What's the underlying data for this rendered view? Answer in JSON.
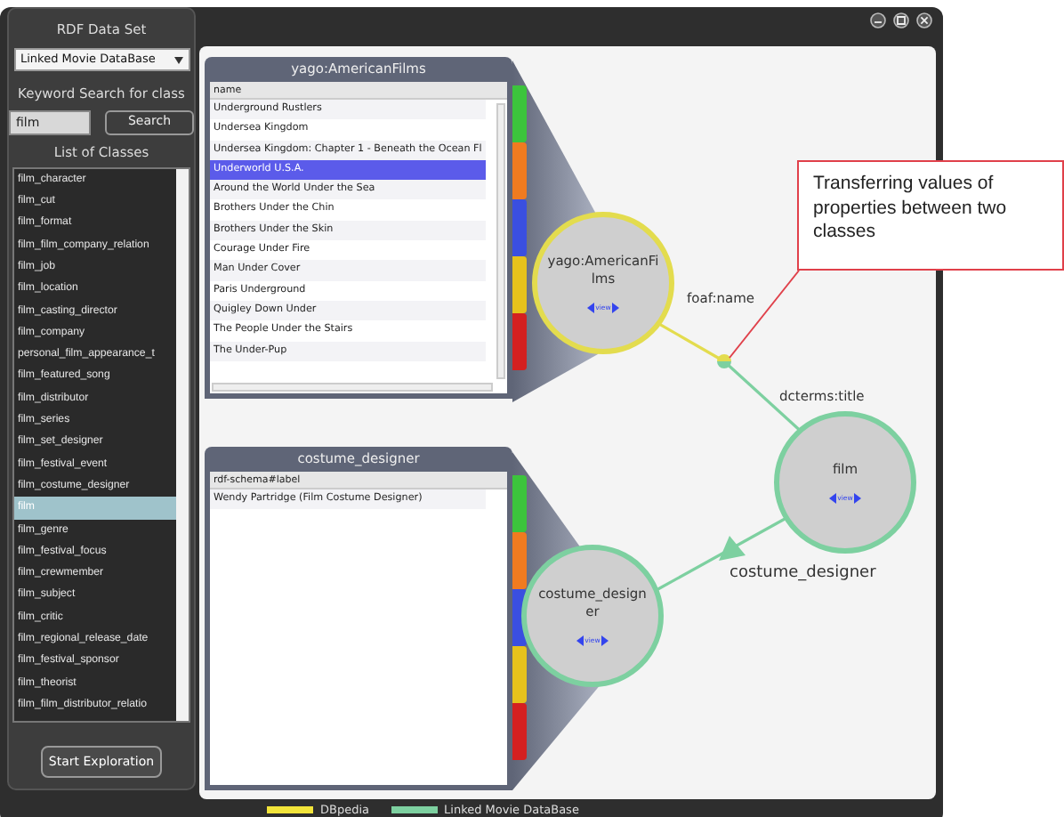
{
  "sidebar": {
    "title": "RDF Data Set",
    "dataset_select": {
      "value": "Linked Movie DataBase"
    },
    "search_label": "Keyword Search for class",
    "search_field": {
      "value": "film"
    },
    "search_button": "Search",
    "list_label": "List of Classes",
    "classes": [
      {
        "label": "film_character",
        "selected": false
      },
      {
        "label": "film_cut",
        "selected": false
      },
      {
        "label": "film_format",
        "selected": false
      },
      {
        "label": "film_film_company_relation",
        "selected": false
      },
      {
        "label": "film_job",
        "selected": false
      },
      {
        "label": "film_location",
        "selected": false
      },
      {
        "label": "film_casting_director",
        "selected": false
      },
      {
        "label": "film_company",
        "selected": false
      },
      {
        "label": "personal_film_appearance_t",
        "selected": false
      },
      {
        "label": "film_featured_song",
        "selected": false
      },
      {
        "label": "film_distributor",
        "selected": false
      },
      {
        "label": "film_series",
        "selected": false
      },
      {
        "label": "film_set_designer",
        "selected": false
      },
      {
        "label": "film_festival_event",
        "selected": false
      },
      {
        "label": "film_costume_designer",
        "selected": false
      },
      {
        "label": "film",
        "selected": true
      },
      {
        "label": "film_genre",
        "selected": false
      },
      {
        "label": "film_festival_focus",
        "selected": false
      },
      {
        "label": "film_crewmember",
        "selected": false
      },
      {
        "label": "film_subject",
        "selected": false
      },
      {
        "label": "film_critic",
        "selected": false
      },
      {
        "label": "film_regional_release_date",
        "selected": false
      },
      {
        "label": "film_festival_sponsor",
        "selected": false
      },
      {
        "label": "film_theorist",
        "selected": false
      },
      {
        "label": "film_film_distributor_relatio",
        "selected": false
      }
    ],
    "start_button": "Start Exploration"
  },
  "panels": [
    {
      "title": "yago:AmericanFilms",
      "columns": [
        "name"
      ],
      "rows": [
        {
          "cells": [
            "Underground Rustlers"
          ],
          "selected": false
        },
        {
          "cells": [
            "Undersea Kingdom"
          ],
          "selected": false
        },
        {
          "cells": [
            "Undersea Kingdom: Chapter 1 - Beneath the Ocean Fl"
          ],
          "selected": false
        },
        {
          "cells": [
            "Underworld U.S.A."
          ],
          "selected": true
        },
        {
          "cells": [
            "Around the World Under the Sea"
          ],
          "selected": false
        },
        {
          "cells": [
            "Brothers Under the Chin"
          ],
          "selected": false
        },
        {
          "cells": [
            "Brothers Under the Skin"
          ],
          "selected": false
        },
        {
          "cells": [
            "Courage Under Fire"
          ],
          "selected": false
        },
        {
          "cells": [
            "Man Under Cover"
          ],
          "selected": false
        },
        {
          "cells": [
            "Paris Underground"
          ],
          "selected": false
        },
        {
          "cells": [
            "Quigley Down Under"
          ],
          "selected": false
        },
        {
          "cells": [
            "The People Under the Stairs"
          ],
          "selected": false
        },
        {
          "cells": [
            "The Under-Pup"
          ],
          "selected": false
        }
      ],
      "tabs": [
        {
          "color": "#3cc43c"
        },
        {
          "color": "#f07b20"
        },
        {
          "color": "#3a4fe0"
        },
        {
          "color": "#e6c21c"
        },
        {
          "color": "#d42020"
        }
      ]
    },
    {
      "title": "costume_designer",
      "columns": [
        "rdf-schema#label"
      ],
      "rows": [
        {
          "cells": [
            "Wendy Partridge (Film Costume Designer)"
          ],
          "selected": false
        }
      ],
      "tabs": [
        {
          "color": "#3cc43c"
        },
        {
          "color": "#f07b20"
        },
        {
          "color": "#3a4fe0"
        },
        {
          "color": "#e6c21c"
        },
        {
          "color": "#d42020"
        }
      ]
    }
  ],
  "graph": {
    "nodes": [
      {
        "label": "yago:AmericanFilms",
        "color": "#e3dc4e",
        "button": "view"
      },
      {
        "label": "film",
        "color": "#7dd0a0",
        "button": "view"
      },
      {
        "label": "costume_designer",
        "color": "#7dd0a0",
        "button": "view"
      }
    ],
    "edges": [
      {
        "label": "foaf:name",
        "color": "#e3dc4e"
      },
      {
        "label": "dcterms:title",
        "color": "#7dd0a0"
      },
      {
        "label": "costume_designer",
        "color": "#7dd0a0"
      }
    ]
  },
  "callout": "Transferring values of properties between two classes",
  "legend": [
    {
      "label": "DBpedia",
      "color": "#f2e43a"
    },
    {
      "label": "Linked Movie DataBase",
      "color": "#7dd0a0"
    }
  ]
}
